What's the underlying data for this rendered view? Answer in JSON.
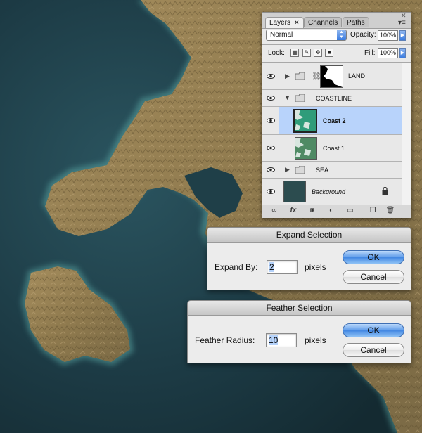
{
  "layers_panel": {
    "tabs": [
      "Layers",
      "Channels",
      "Paths"
    ],
    "tab_close": "✕",
    "panel_menu_icon": "panel-menu-icon",
    "blend_mode": "Normal",
    "opacity_label": "Opacity:",
    "opacity_value": "100%",
    "lock_label": "Lock:",
    "fill_label": "Fill:",
    "fill_value": "100%",
    "layers": [
      {
        "name": "LAND",
        "kind": "group"
      },
      {
        "name": "COASTLINE",
        "kind": "group-open"
      },
      {
        "name": "Coast 2",
        "kind": "layer",
        "selected": true
      },
      {
        "name": "Coast 1",
        "kind": "layer"
      },
      {
        "name": "SEA",
        "kind": "group"
      },
      {
        "name": "Background",
        "kind": "background",
        "locked": true
      }
    ]
  },
  "expand_dialog": {
    "title": "Expand Selection",
    "label": "Expand By:",
    "value": "2",
    "unit": "pixels",
    "ok": "OK",
    "cancel": "Cancel"
  },
  "feather_dialog": {
    "title": "Feather Selection",
    "label": "Feather Radius:",
    "value": "10",
    "unit": "pixels",
    "ok": "OK",
    "cancel": "Cancel"
  },
  "colors": {
    "sea": "#21414b",
    "land": "#9c8556",
    "coast_glow": "#5aa6a3",
    "selection_highlight": "#b8d3fb"
  }
}
